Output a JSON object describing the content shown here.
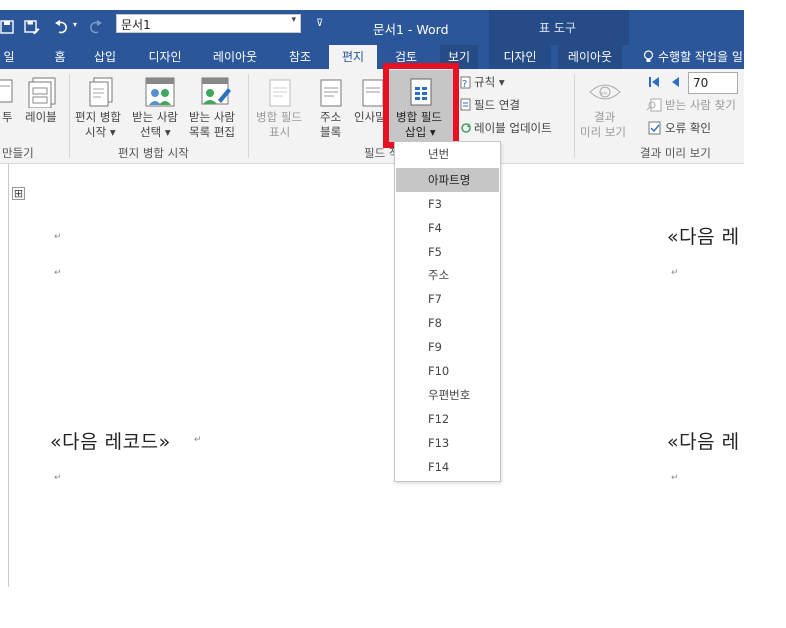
{
  "window": {
    "doc_title": "문서1 - Word",
    "context_tab_group": "표 도구",
    "font_box_value": "문서1"
  },
  "tabs": [
    {
      "label": "일"
    },
    {
      "label": "홈"
    },
    {
      "label": "삽입"
    },
    {
      "label": "디자인"
    },
    {
      "label": "레이아웃"
    },
    {
      "label": "참조"
    },
    {
      "label": "편지",
      "active": true
    },
    {
      "label": "검토"
    },
    {
      "label": "보기"
    },
    {
      "label": "디자인"
    },
    {
      "label": "레이아웃"
    }
  ],
  "tell_me": "수행할 작업을 일",
  "ribbon": {
    "group_create_label": "만들기",
    "envelope_frag": "투",
    "labels_label": "레이블",
    "start_merge": {
      "line1": "편지 병합",
      "line2": "시작 ▾"
    },
    "select_recipients": {
      "line1": "받는 사람",
      "line2": "선택 ▾"
    },
    "edit_list": {
      "line1": "받는 사람",
      "line2": "목록 편집"
    },
    "group_start_label": "편지 병합 시작",
    "highlight_fields": {
      "line1": "병합 필드",
      "line2": "표시"
    },
    "address_block": {
      "line1": "주소",
      "line2": "블록"
    },
    "greeting_frag": "인사말",
    "insert_merge_field": {
      "line1": "병합 필드",
      "line2": "삽입 ▾"
    },
    "rules": "규칙 ▾",
    "match_fields": "필드 연결",
    "update_labels": "레이블 업데이트",
    "group_fields_label": "필드 작",
    "preview_results": {
      "line1": "결과",
      "line2": "미리 보기"
    },
    "record_number": "70",
    "find_recipient": "받는 사람 찾기",
    "check_errors": "오류 확인",
    "group_preview_label": "결과 미리 보기"
  },
  "dropdown": {
    "items": [
      "년번",
      "아파트명",
      "F3",
      "F4",
      "F5",
      "주소",
      "F7",
      "F8",
      "F9",
      "F10",
      "우편번호",
      "F12",
      "F13",
      "F14"
    ],
    "highlighted_index": 1
  },
  "document": {
    "next_record": "«다음 레코드»",
    "next_record_partial": "«다음 레"
  },
  "colors": {
    "word_blue": "#2b579a",
    "highlight_box": "#e81123"
  }
}
